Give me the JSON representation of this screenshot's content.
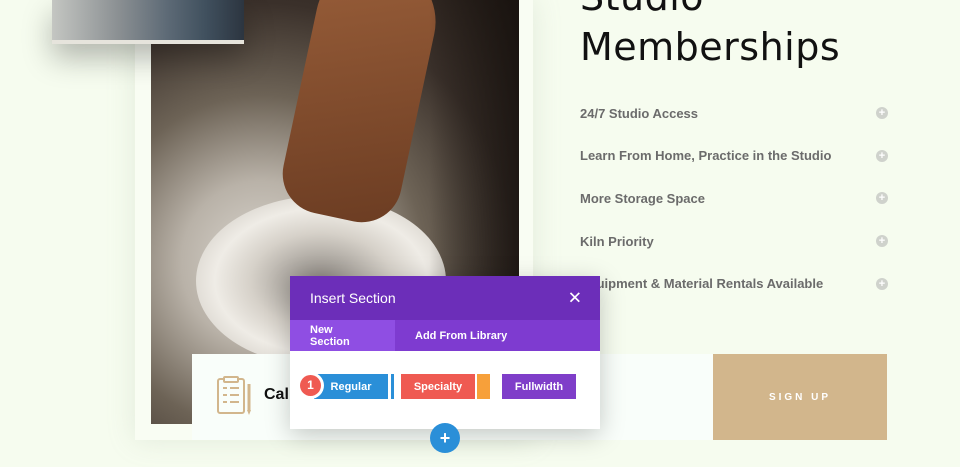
{
  "page": {
    "title": "Studio\nMemberships",
    "features": [
      "24/7 Studio Access",
      "Learn From Home, Practice in the Studio",
      "More Storage Space",
      "Kiln Priority",
      "Equipment & Material Rentals Available"
    ],
    "cta_text": "Call",
    "signup_label": "SIGN UP"
  },
  "modal": {
    "title": "Insert Section",
    "tabs": [
      "New Section",
      "Add From Library"
    ],
    "buttons": {
      "regular": "Regular",
      "specialty": "Specialty",
      "fullwidth": "Fullwidth"
    },
    "step_badge": "1"
  },
  "icons": {
    "close": "close-icon",
    "add": "add-section-icon",
    "expand": "plus-circle-icon",
    "checklist": "checklist-icon"
  },
  "colors": {
    "modal_header": "#6c2eb9",
    "tabs_bar": "#7e3bd0",
    "regular": "#2a8fd8",
    "specialty": "#ef5a52",
    "fullwidth": "#7f3ec9",
    "signup": "#d2b68c"
  }
}
